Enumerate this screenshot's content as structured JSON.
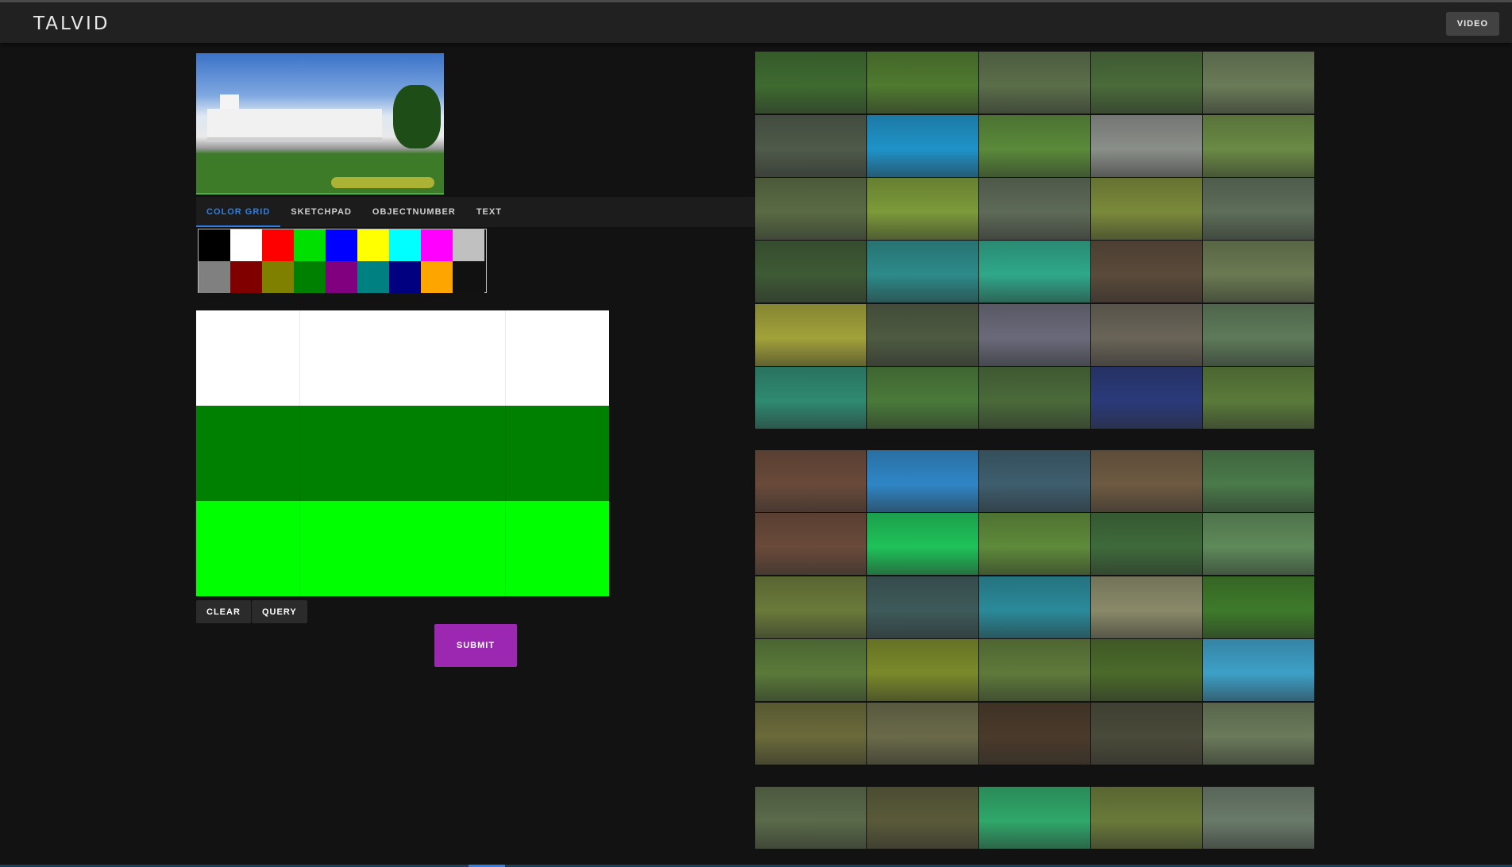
{
  "app": {
    "title": "TALVID",
    "video_button": "VIDEO"
  },
  "tabs": [
    {
      "label": "COLOR GRID",
      "active": true
    },
    {
      "label": "SKETCHPAD",
      "active": false
    },
    {
      "label": "OBJECTNUMBER",
      "active": false
    },
    {
      "label": "TEXT",
      "active": false
    }
  ],
  "palette": [
    "#000000",
    "#ffffff",
    "#ff0000",
    "#00e000",
    "#0000ff",
    "#ffff00",
    "#00ffff",
    "#ff00ff",
    "#c0c0c0",
    "#808080",
    "#800000",
    "#808000",
    "#008000",
    "#800080",
    "#008080",
    "#000080",
    "#ffa500",
    "#111111"
  ],
  "grid_colors": [
    [
      "#ffffff",
      "#ffffff",
      "#ffffff"
    ],
    [
      "#008000",
      "#008000",
      "#008000"
    ],
    [
      "#00ff00",
      "#00ff00",
      "#00ff00"
    ]
  ],
  "buttons": {
    "clear": "CLEAR",
    "query": "QUERY",
    "submit": "SUBMIT"
  },
  "thumbnail_colors": [
    [
      "#3e6b30",
      "#4f7a2f",
      "#5b6e4a",
      "#4a6b3a",
      "#6a7b58"
    ],
    [
      "#4f5a4a",
      "#1f93c9",
      "#5a8a3a",
      "#8b8f8a",
      "#6a8a45"
    ],
    [
      "#5a6b44",
      "#7c9a3a",
      "#5e6a58",
      "#7a8a3a",
      "#5d6e5a"
    ],
    [
      "#3e5a35",
      "#2d8a8a",
      "#2fa88a",
      "#5a4a3a",
      "#6a7a52"
    ],
    [
      "#a2a23a",
      "#4e5a42",
      "#6a6a7a",
      "#6a6458",
      "#5e7a5a"
    ],
    [
      "#2f8a72",
      "#4a7a3a",
      "#4a6a3a",
      "#2a3a7a",
      "#5a7a3a"
    ],
    [
      "#6a4a3a",
      "#2f86c6",
      "#3e5e6e",
      "#6e5a42",
      "#4a7a4a"
    ],
    [
      "#6a4a3a",
      "#1fc25a",
      "#5e8a3a",
      "#3e6a3a",
      "#5e8a5a"
    ],
    [
      "#6a7a3a",
      "#3e5a5a",
      "#2a8a9a",
      "#8a8a6a",
      "#3e7a2a"
    ],
    [
      "#5a7a3a",
      "#7a8a2a",
      "#5e7a3a",
      "#4a6a2a",
      "#3ea0c8"
    ],
    [
      "#6a6a3a",
      "#6a6a4a",
      "#4a3a2a",
      "#4a4a3a",
      "#6a7a5a"
    ],
    [
      "#5a6a4a",
      "#5a5a3a",
      "#2fa86a",
      "#6a7a3a",
      "#6a7a6a"
    ]
  ]
}
